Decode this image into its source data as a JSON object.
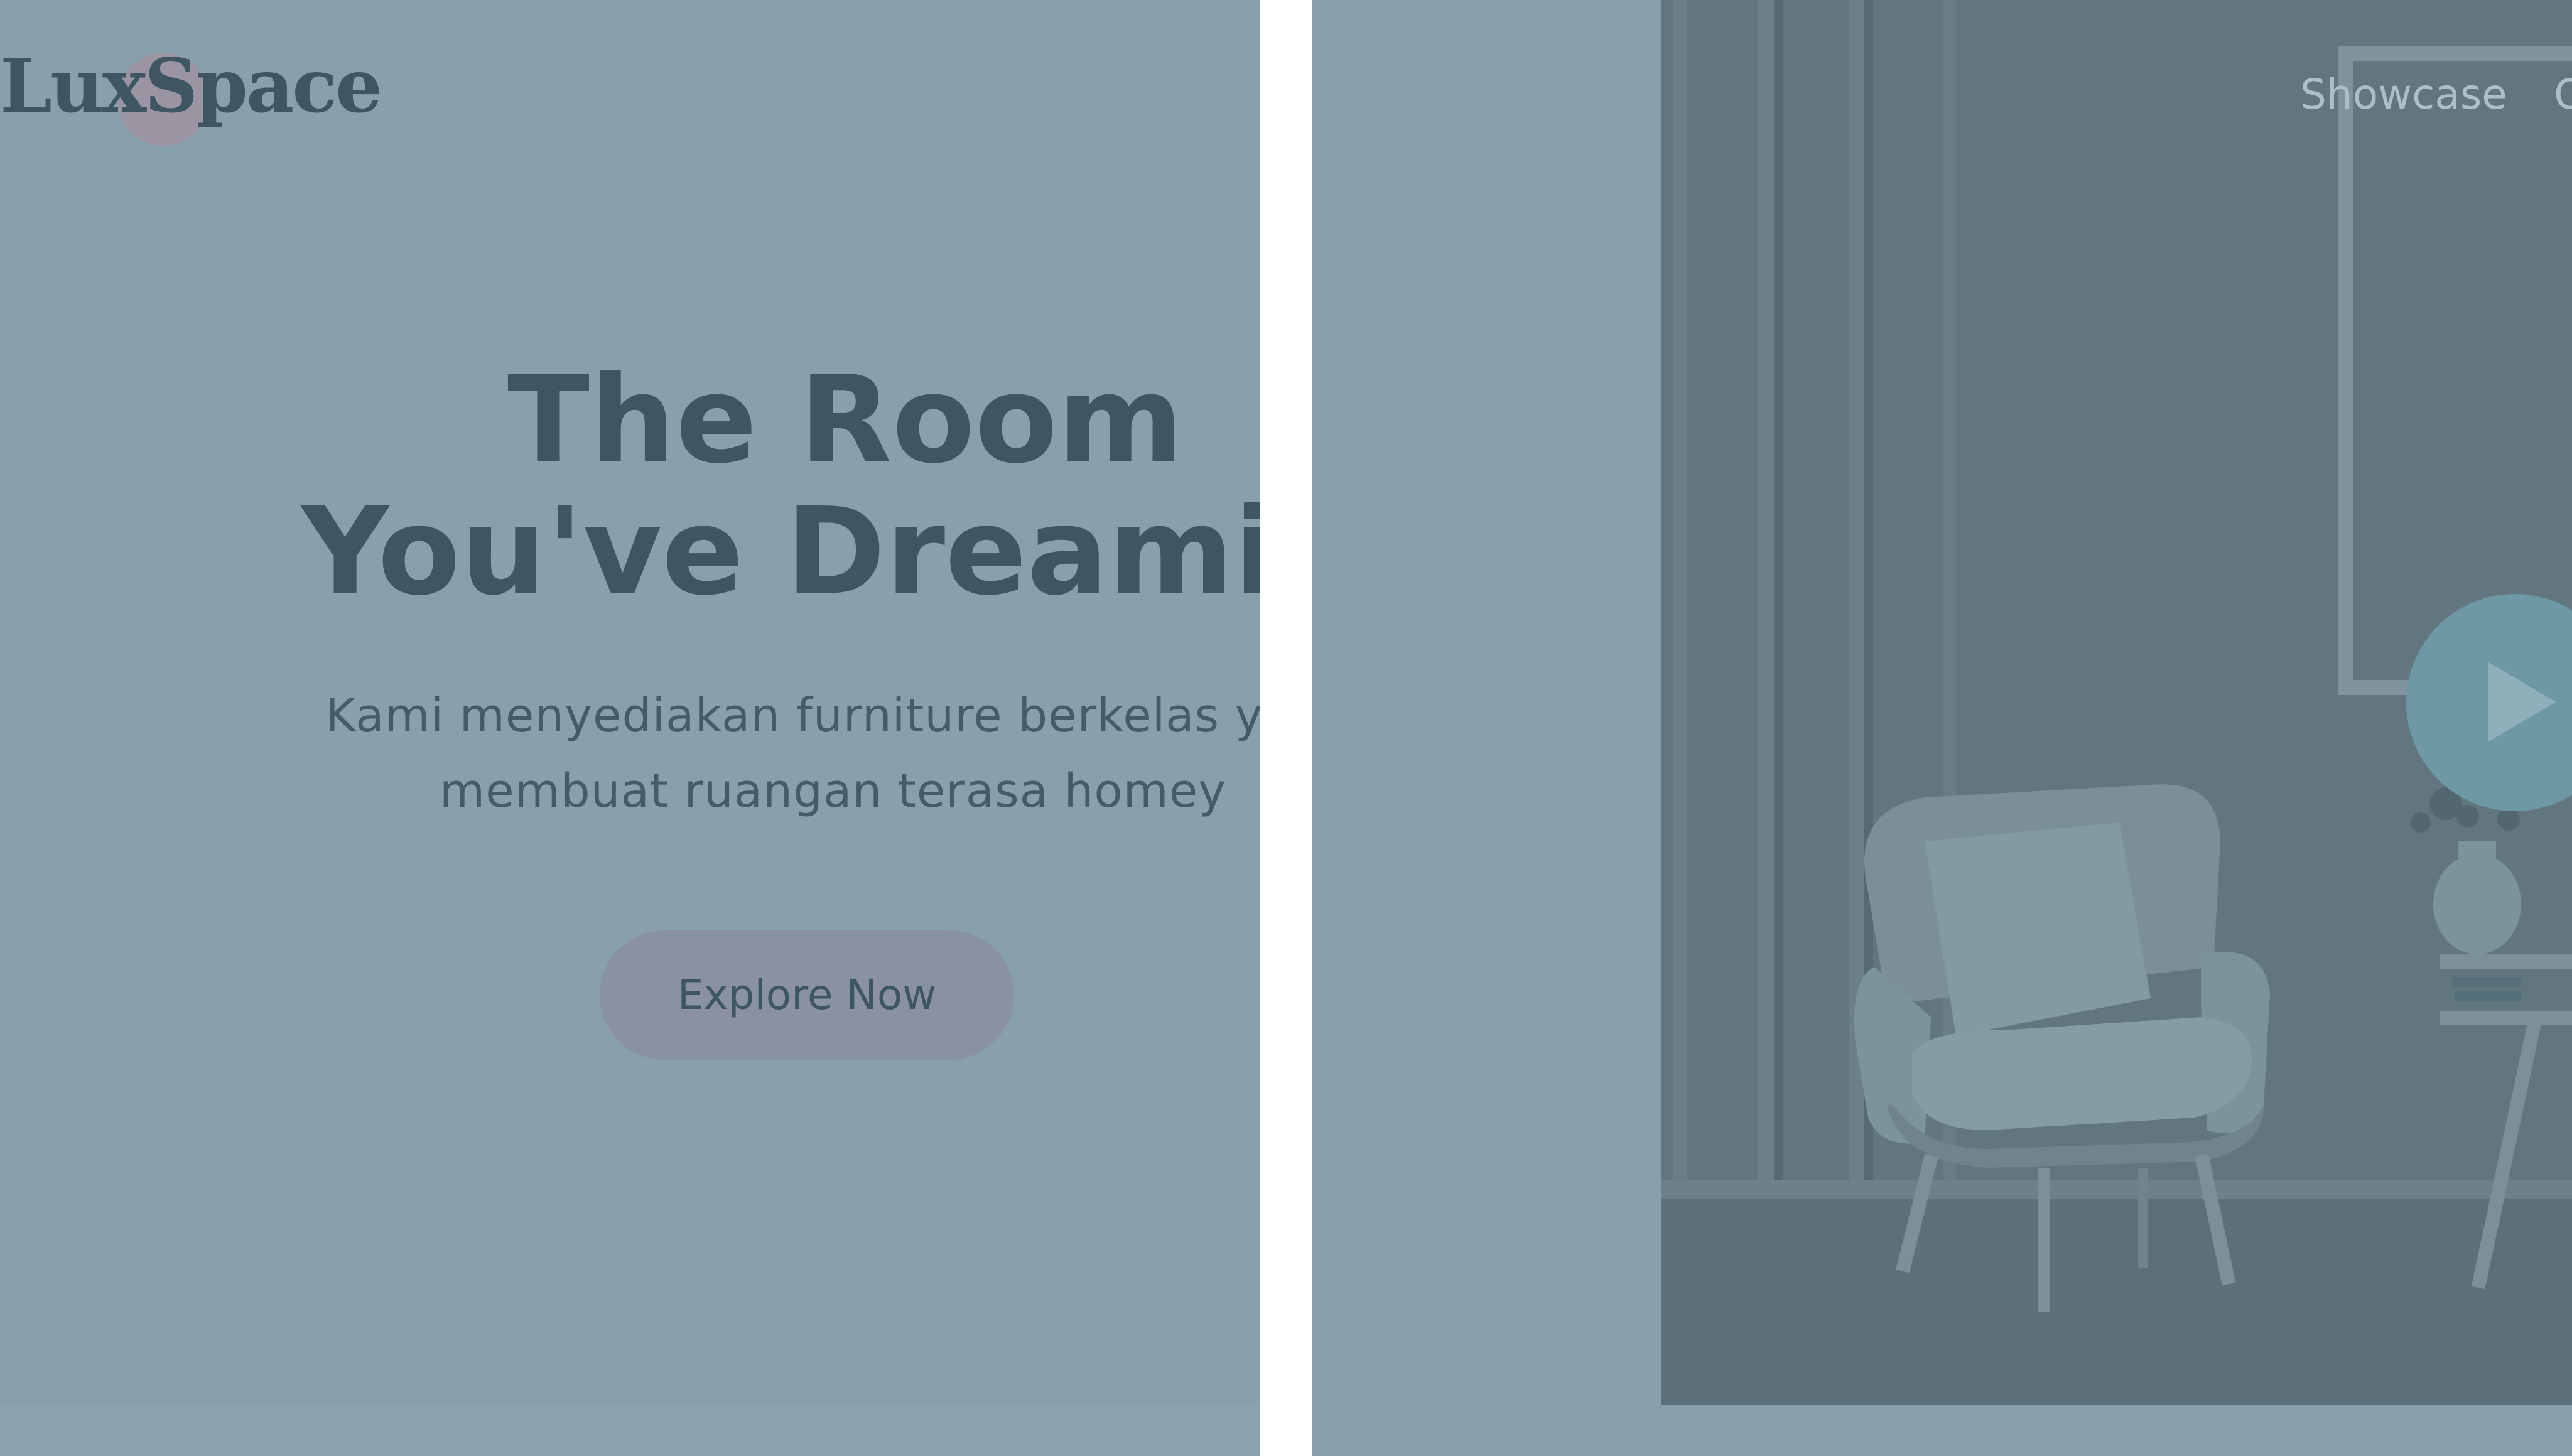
{
  "brand": {
    "name": "LuxSpace"
  },
  "hero": {
    "title_line1": "The Room",
    "title_line2": "You've Dreaming",
    "subtitle_line1": "Kami menyediakan furniture berkelas yang",
    "subtitle_line2": "membuat ruangan terasa homey",
    "cta_label": "Explore Now"
  },
  "nav": {
    "items": [
      {
        "label": "Showcase"
      },
      {
        "label": "C"
      }
    ]
  },
  "media": {
    "play_icon": "play-icon",
    "image_subject": "armchair"
  },
  "colors": {
    "panel_background": "#87a0ab",
    "heading": "#3e5562",
    "cta_background": "#8a92a1",
    "play_button": "#6f98a5"
  }
}
